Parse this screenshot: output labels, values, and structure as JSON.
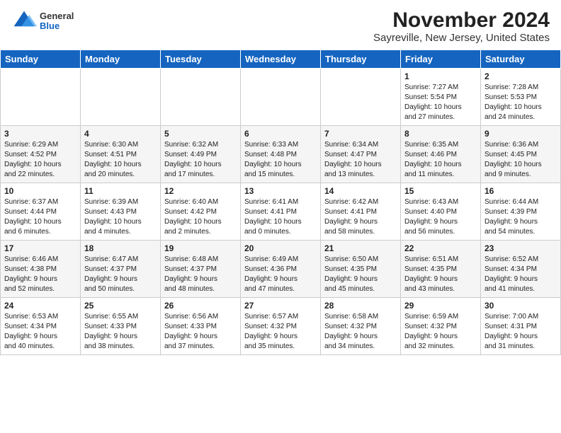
{
  "logo": {
    "general": "General",
    "blue": "Blue"
  },
  "title": "November 2024",
  "subtitle": "Sayreville, New Jersey, United States",
  "days_of_week": [
    "Sunday",
    "Monday",
    "Tuesday",
    "Wednesday",
    "Thursday",
    "Friday",
    "Saturday"
  ],
  "weeks": [
    [
      {
        "day": "",
        "info": ""
      },
      {
        "day": "",
        "info": ""
      },
      {
        "day": "",
        "info": ""
      },
      {
        "day": "",
        "info": ""
      },
      {
        "day": "",
        "info": ""
      },
      {
        "day": "1",
        "info": "Sunrise: 7:27 AM\nSunset: 5:54 PM\nDaylight: 10 hours\nand 27 minutes."
      },
      {
        "day": "2",
        "info": "Sunrise: 7:28 AM\nSunset: 5:53 PM\nDaylight: 10 hours\nand 24 minutes."
      }
    ],
    [
      {
        "day": "3",
        "info": "Sunrise: 6:29 AM\nSunset: 4:52 PM\nDaylight: 10 hours\nand 22 minutes."
      },
      {
        "day": "4",
        "info": "Sunrise: 6:30 AM\nSunset: 4:51 PM\nDaylight: 10 hours\nand 20 minutes."
      },
      {
        "day": "5",
        "info": "Sunrise: 6:32 AM\nSunset: 4:49 PM\nDaylight: 10 hours\nand 17 minutes."
      },
      {
        "day": "6",
        "info": "Sunrise: 6:33 AM\nSunset: 4:48 PM\nDaylight: 10 hours\nand 15 minutes."
      },
      {
        "day": "7",
        "info": "Sunrise: 6:34 AM\nSunset: 4:47 PM\nDaylight: 10 hours\nand 13 minutes."
      },
      {
        "day": "8",
        "info": "Sunrise: 6:35 AM\nSunset: 4:46 PM\nDaylight: 10 hours\nand 11 minutes."
      },
      {
        "day": "9",
        "info": "Sunrise: 6:36 AM\nSunset: 4:45 PM\nDaylight: 10 hours\nand 9 minutes."
      }
    ],
    [
      {
        "day": "10",
        "info": "Sunrise: 6:37 AM\nSunset: 4:44 PM\nDaylight: 10 hours\nand 6 minutes."
      },
      {
        "day": "11",
        "info": "Sunrise: 6:39 AM\nSunset: 4:43 PM\nDaylight: 10 hours\nand 4 minutes."
      },
      {
        "day": "12",
        "info": "Sunrise: 6:40 AM\nSunset: 4:42 PM\nDaylight: 10 hours\nand 2 minutes."
      },
      {
        "day": "13",
        "info": "Sunrise: 6:41 AM\nSunset: 4:41 PM\nDaylight: 10 hours\nand 0 minutes."
      },
      {
        "day": "14",
        "info": "Sunrise: 6:42 AM\nSunset: 4:41 PM\nDaylight: 9 hours\nand 58 minutes."
      },
      {
        "day": "15",
        "info": "Sunrise: 6:43 AM\nSunset: 4:40 PM\nDaylight: 9 hours\nand 56 minutes."
      },
      {
        "day": "16",
        "info": "Sunrise: 6:44 AM\nSunset: 4:39 PM\nDaylight: 9 hours\nand 54 minutes."
      }
    ],
    [
      {
        "day": "17",
        "info": "Sunrise: 6:46 AM\nSunset: 4:38 PM\nDaylight: 9 hours\nand 52 minutes."
      },
      {
        "day": "18",
        "info": "Sunrise: 6:47 AM\nSunset: 4:37 PM\nDaylight: 9 hours\nand 50 minutes."
      },
      {
        "day": "19",
        "info": "Sunrise: 6:48 AM\nSunset: 4:37 PM\nDaylight: 9 hours\nand 48 minutes."
      },
      {
        "day": "20",
        "info": "Sunrise: 6:49 AM\nSunset: 4:36 PM\nDaylight: 9 hours\nand 47 minutes."
      },
      {
        "day": "21",
        "info": "Sunrise: 6:50 AM\nSunset: 4:35 PM\nDaylight: 9 hours\nand 45 minutes."
      },
      {
        "day": "22",
        "info": "Sunrise: 6:51 AM\nSunset: 4:35 PM\nDaylight: 9 hours\nand 43 minutes."
      },
      {
        "day": "23",
        "info": "Sunrise: 6:52 AM\nSunset: 4:34 PM\nDaylight: 9 hours\nand 41 minutes."
      }
    ],
    [
      {
        "day": "24",
        "info": "Sunrise: 6:53 AM\nSunset: 4:34 PM\nDaylight: 9 hours\nand 40 minutes."
      },
      {
        "day": "25",
        "info": "Sunrise: 6:55 AM\nSunset: 4:33 PM\nDaylight: 9 hours\nand 38 minutes."
      },
      {
        "day": "26",
        "info": "Sunrise: 6:56 AM\nSunset: 4:33 PM\nDaylight: 9 hours\nand 37 minutes."
      },
      {
        "day": "27",
        "info": "Sunrise: 6:57 AM\nSunset: 4:32 PM\nDaylight: 9 hours\nand 35 minutes."
      },
      {
        "day": "28",
        "info": "Sunrise: 6:58 AM\nSunset: 4:32 PM\nDaylight: 9 hours\nand 34 minutes."
      },
      {
        "day": "29",
        "info": "Sunrise: 6:59 AM\nSunset: 4:32 PM\nDaylight: 9 hours\nand 32 minutes."
      },
      {
        "day": "30",
        "info": "Sunrise: 7:00 AM\nSunset: 4:31 PM\nDaylight: 9 hours\nand 31 minutes."
      }
    ]
  ]
}
